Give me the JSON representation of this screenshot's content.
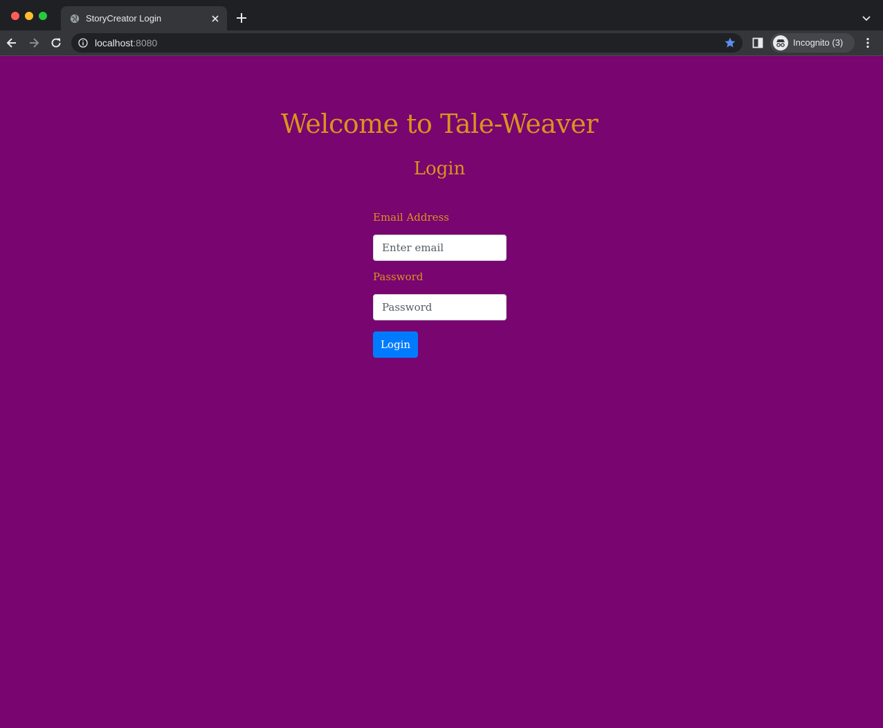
{
  "browser": {
    "tab": {
      "title": "StoryCreator Login"
    },
    "address_bar": {
      "host": "localhost",
      "port": ":8080"
    },
    "profile": {
      "label": "Incognito (3)"
    }
  },
  "page": {
    "title": "Welcome to Tale-Weaver",
    "subtitle": "Login",
    "form": {
      "email_label": "Email Address",
      "email_placeholder": "Enter email",
      "email_value": "",
      "password_label": "Password",
      "password_placeholder": "Password",
      "password_value": "",
      "submit_label": "Login"
    }
  },
  "colors": {
    "page_background": "#780570",
    "heading_text": "#d9941e",
    "primary_button": "#007bff"
  }
}
